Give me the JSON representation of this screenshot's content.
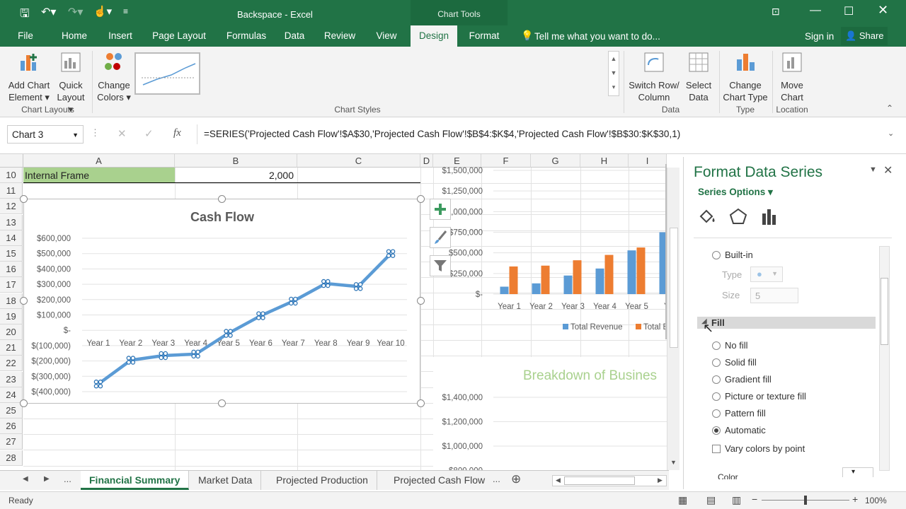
{
  "titlebar": {
    "title": "Backspace - Excel",
    "context_label": "Chart Tools"
  },
  "tabs": [
    {
      "label": "File"
    },
    {
      "label": "Home"
    },
    {
      "label": "Insert"
    },
    {
      "label": "Page Layout"
    },
    {
      "label": "Formulas"
    },
    {
      "label": "Data"
    },
    {
      "label": "Review"
    },
    {
      "label": "View"
    },
    {
      "label": "Design"
    },
    {
      "label": "Format"
    }
  ],
  "tell_me": "Tell me what you want to do...",
  "signin": "Sign in",
  "share": "Share",
  "ribbon": {
    "add_chart_element": [
      "Add Chart",
      "Element ▾"
    ],
    "quick_layout": [
      "Quick",
      "Layout ▾"
    ],
    "change_colors": [
      "Change",
      "Colors ▾"
    ],
    "switch_row_col": [
      "Switch Row/",
      "Column"
    ],
    "select_data": [
      "Select",
      "Data"
    ],
    "change_chart_type": [
      "Change",
      "Chart Type"
    ],
    "move_chart": [
      "Move",
      "Chart"
    ],
    "groups": {
      "chart_layouts": "Chart Layouts",
      "chart_styles": "Chart Styles",
      "data": "Data",
      "type": "Type",
      "location": "Location"
    }
  },
  "formula_bar": {
    "name_box": "Chart 3",
    "formula": "=SERIES('Projected Cash Flow'!$A$30,'Projected Cash Flow'!$B$4:$K$4,'Projected Cash Flow'!$B$30:$K$30,1)"
  },
  "columns": [
    "A",
    "B",
    "C",
    "D",
    "E",
    "F",
    "G",
    "H",
    "I"
  ],
  "rows": [
    "10",
    "11",
    "12",
    "13",
    "14",
    "15",
    "16",
    "17",
    "18",
    "19",
    "20",
    "21",
    "22",
    "23",
    "24",
    "25",
    "26",
    "27",
    "28"
  ],
  "cells": {
    "a10": "Internal Frame",
    "b10": "2,000"
  },
  "chart_data": [
    {
      "type": "line",
      "title": "Cash Flow",
      "categories": [
        "Year 1",
        "Year 2",
        "Year 3",
        "Year 4",
        "Year 5",
        "Year 6",
        "Year 7",
        "Year 8",
        "Year 9",
        "Year 10"
      ],
      "values": [
        -350000,
        -195000,
        -165000,
        -155000,
        -20000,
        95000,
        190000,
        305000,
        285000,
        500000
      ],
      "ylim": [
        -400000,
        600000
      ],
      "yticks": [
        "$600,000",
        "$500,000",
        "$400,000",
        "$300,000",
        "$200,000",
        "$100,000",
        "$-",
        "$(100,000)",
        "$(200,000)",
        "$(300,000)",
        "$(400,000)"
      ],
      "grid": true,
      "color": "#5b9bd5"
    },
    {
      "type": "bar",
      "categories": [
        "Year 1",
        "Year 2",
        "Year 3",
        "Year 4",
        "Year 5",
        "Ye"
      ],
      "series": [
        {
          "name": "Total Revenue",
          "values": [
            90000,
            130000,
            225000,
            310000,
            530000,
            750000
          ],
          "color": "#5b9bd5"
        },
        {
          "name": "Total E",
          "values": [
            335000,
            345000,
            410000,
            475000,
            565000,
            null
          ],
          "color": "#ed7d31"
        }
      ],
      "ylim": [
        0,
        1500000
      ],
      "yticks": [
        "$1,500,000",
        "$1,250,000",
        "$1,000,000",
        "$750,000",
        "$500,000",
        "$250,000",
        "$-"
      ],
      "legend": "bottom"
    },
    {
      "type": "line",
      "title": "Breakdown of Busines",
      "yticks": [
        "$1,400,000",
        "$1,200,000",
        "$1,000,000",
        "$800,000"
      ],
      "title_color": "#a9d18e"
    }
  ],
  "pane": {
    "title": "Format Data Series",
    "series_options": "Series Options ▾",
    "builtin": "Built-in",
    "type_label": "Type",
    "size_label": "Size",
    "size_value": "5",
    "fill_header": "Fill",
    "fill_options": [
      {
        "label": "No fill",
        "checked": false
      },
      {
        "label": "Solid fill",
        "checked": false
      },
      {
        "label": "Gradient fill",
        "checked": false
      },
      {
        "label": "Picture or texture fill",
        "checked": false
      },
      {
        "label": "Pattern fill",
        "checked": false
      },
      {
        "label": "Automatic",
        "checked": true
      }
    ],
    "vary_colors": "Vary colors by point",
    "color_label": "Color"
  },
  "sheet_tabs": [
    {
      "label": "Financial Summary",
      "selected": true
    },
    {
      "label": "Market Data"
    },
    {
      "label": "Projected Production"
    },
    {
      "label": "Projected Cash Flow"
    }
  ],
  "status": {
    "ready": "Ready",
    "zoom": "100%"
  }
}
